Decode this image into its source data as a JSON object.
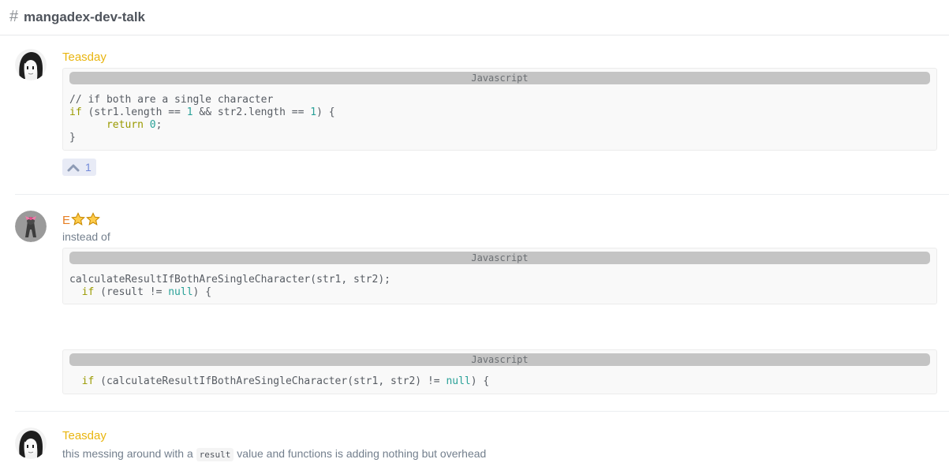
{
  "channel": {
    "hash": "#",
    "name": "mangadex-dev-talk"
  },
  "messages": [
    {
      "author": "Teasday",
      "code": {
        "language": "Javascript",
        "lines": [
          "// if both are a single character",
          "if (str1.length == 1 && str2.length == 1) {",
          "      return 0;",
          "}"
        ]
      },
      "reaction": {
        "icon": "chevron-up-icon",
        "count": "1"
      }
    },
    {
      "author": "E",
      "author_badges": [
        "star-icon",
        "star-icon"
      ],
      "text": "instead of",
      "code_blocks": [
        {
          "language": "Javascript",
          "lines": [
            "calculateResultIfBothAreSingleCharacter(str1, str2);",
            "  if (result != null) {"
          ]
        },
        {
          "language": "Javascript",
          "lines": [
            "  if (calculateResultIfBothAreSingleCharacter(str1, str2) != null) {"
          ]
        }
      ]
    },
    {
      "author": "Teasday",
      "text_before": "this messing around with a",
      "inline_code": "result",
      "text_after": "value and functions is adding nothing but overhead"
    }
  ],
  "colors": {
    "teasday": "#e9b50f",
    "e_author": "#e67e22",
    "keyword": "#9a9a00",
    "number": "#2aa198",
    "reaction_bg": "#e8ebf6"
  }
}
